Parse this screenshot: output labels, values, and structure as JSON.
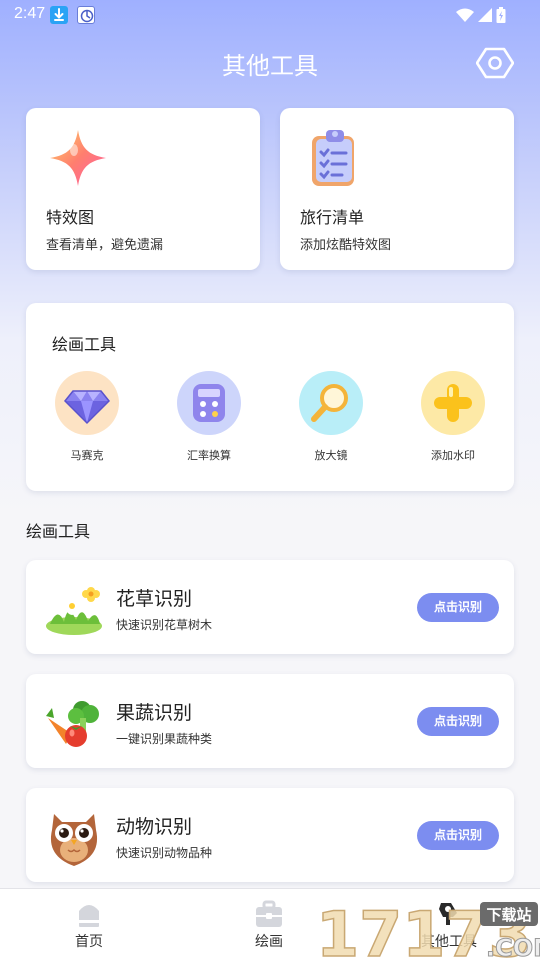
{
  "status_bar": {
    "time": "2:47"
  },
  "header": {
    "title": "其他工具"
  },
  "feature_cards": [
    {
      "title": "特效图",
      "subtitle": "查看清单，避免遗漏",
      "icon": "sparkle-star-icon"
    },
    {
      "title": "旅行清单",
      "subtitle": "添加炫酷特效图",
      "icon": "clipboard-checklist-icon"
    }
  ],
  "tools_panel": {
    "title": "绘画工具",
    "items": [
      {
        "label": "马赛克",
        "icon": "diamond-icon",
        "bg": "#fde3c4"
      },
      {
        "label": "汇率换算",
        "icon": "calculator-icon",
        "bg": "#cdd5fb"
      },
      {
        "label": "放大镜",
        "icon": "magnifier-icon",
        "bg": "#b9eef8"
      },
      {
        "label": "添加水印",
        "icon": "plus-icon",
        "bg": "#fde9a6"
      }
    ]
  },
  "section_title": "绘画工具",
  "recognition": [
    {
      "title": "花草识别",
      "subtitle": "快速识别花草树木",
      "button": "点击识别",
      "icon": "flower-grass-icon"
    },
    {
      "title": "果蔬识别",
      "subtitle": "一键识别果蔬种类",
      "button": "点击识别",
      "icon": "vegetables-icon"
    },
    {
      "title": "动物识别",
      "subtitle": "快速识别动物品种",
      "button": "点击识别",
      "icon": "owl-icon"
    }
  ],
  "bottom_nav": [
    {
      "label": "首页",
      "icon": "home-icon"
    },
    {
      "label": "绘画",
      "icon": "briefcase-icon"
    },
    {
      "label": "其他工具",
      "icon": "tools-icon"
    }
  ],
  "watermark": {
    "text_main": "17173",
    "text_badge": "下载站",
    "text_suffix": ".COM"
  },
  "colors": {
    "accent": "#7c8df0",
    "header_gradient_top": "#9fb0ff"
  }
}
